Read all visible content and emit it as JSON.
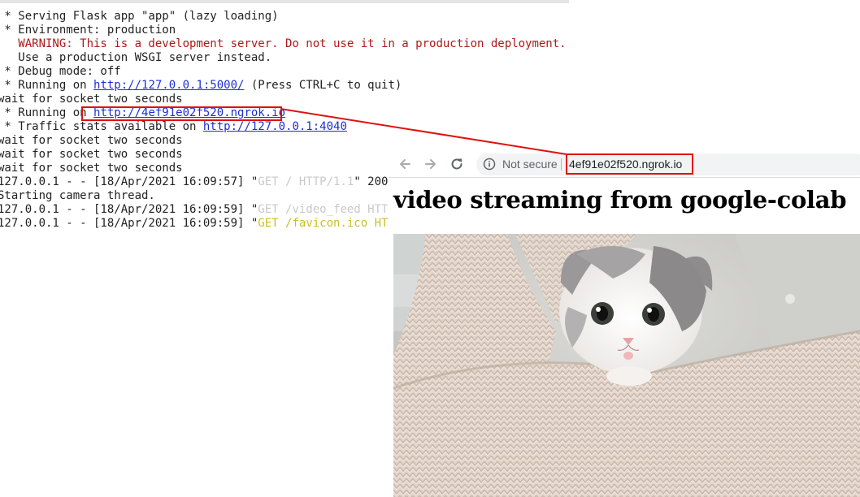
{
  "terminal": {
    "lines": [
      {
        "prefix": " * Serving Flask app \"app\" (lazy loading)"
      },
      {
        "prefix": " * Environment: production"
      },
      {
        "warning": "   WARNING: This is a development server. Do not use it in a production deployment."
      },
      {
        "prefix": "   Use a production WSGI server instead."
      },
      {
        "prefix": " * Debug mode: off"
      },
      {
        "prefix": " * Running on ",
        "link": "http://127.0.0.1:5000/",
        "suffix": " (Press CTRL+C to quit)"
      },
      {
        "prefix": "wait for socket two seconds"
      },
      {
        "prefix": " * Running on ",
        "link": "http://4ef91e02f520.ngrok.io"
      },
      {
        "prefix": " * Traffic stats available on ",
        "link": "http://127.0.0.1:4040"
      },
      {
        "prefix": "wait for socket two seconds"
      },
      {
        "prefix": "wait for socket two seconds"
      },
      {
        "prefix": "wait for socket two seconds"
      },
      {
        "prefix": "127.0.0.1 - - [18/Apr/2021 16:09:57] \"",
        "dim": "GET / HTTP/1.1",
        "suffix": "\" 200"
      },
      {
        "prefix": "Starting camera thread."
      },
      {
        "prefix": "127.0.0.1 - - [18/Apr/2021 16:09:59] \"",
        "dim": "GET /video_feed HTTP"
      },
      {
        "prefix": "127.0.0.1 - - [18/Apr/2021 16:09:59] \"",
        "yellow": "GET /favicon.ico HTT"
      }
    ]
  },
  "browser": {
    "back_icon": "back-arrow-icon",
    "forward_icon": "forward-arrow-icon",
    "reload_icon": "reload-icon",
    "security_icon": "info-circle-icon",
    "security_label": "Not secure",
    "url": "4ef91e02f520.ngrok.io"
  },
  "page": {
    "heading": "video streaming from google-colab",
    "video_subject": "kitten in knitted sweater"
  },
  "colors": {
    "highlight": "#e01010",
    "link": "#1b2fd6",
    "warning": "#b01818",
    "log_dim": "#c9c9c9",
    "log_yellow": "#c9bf28"
  }
}
